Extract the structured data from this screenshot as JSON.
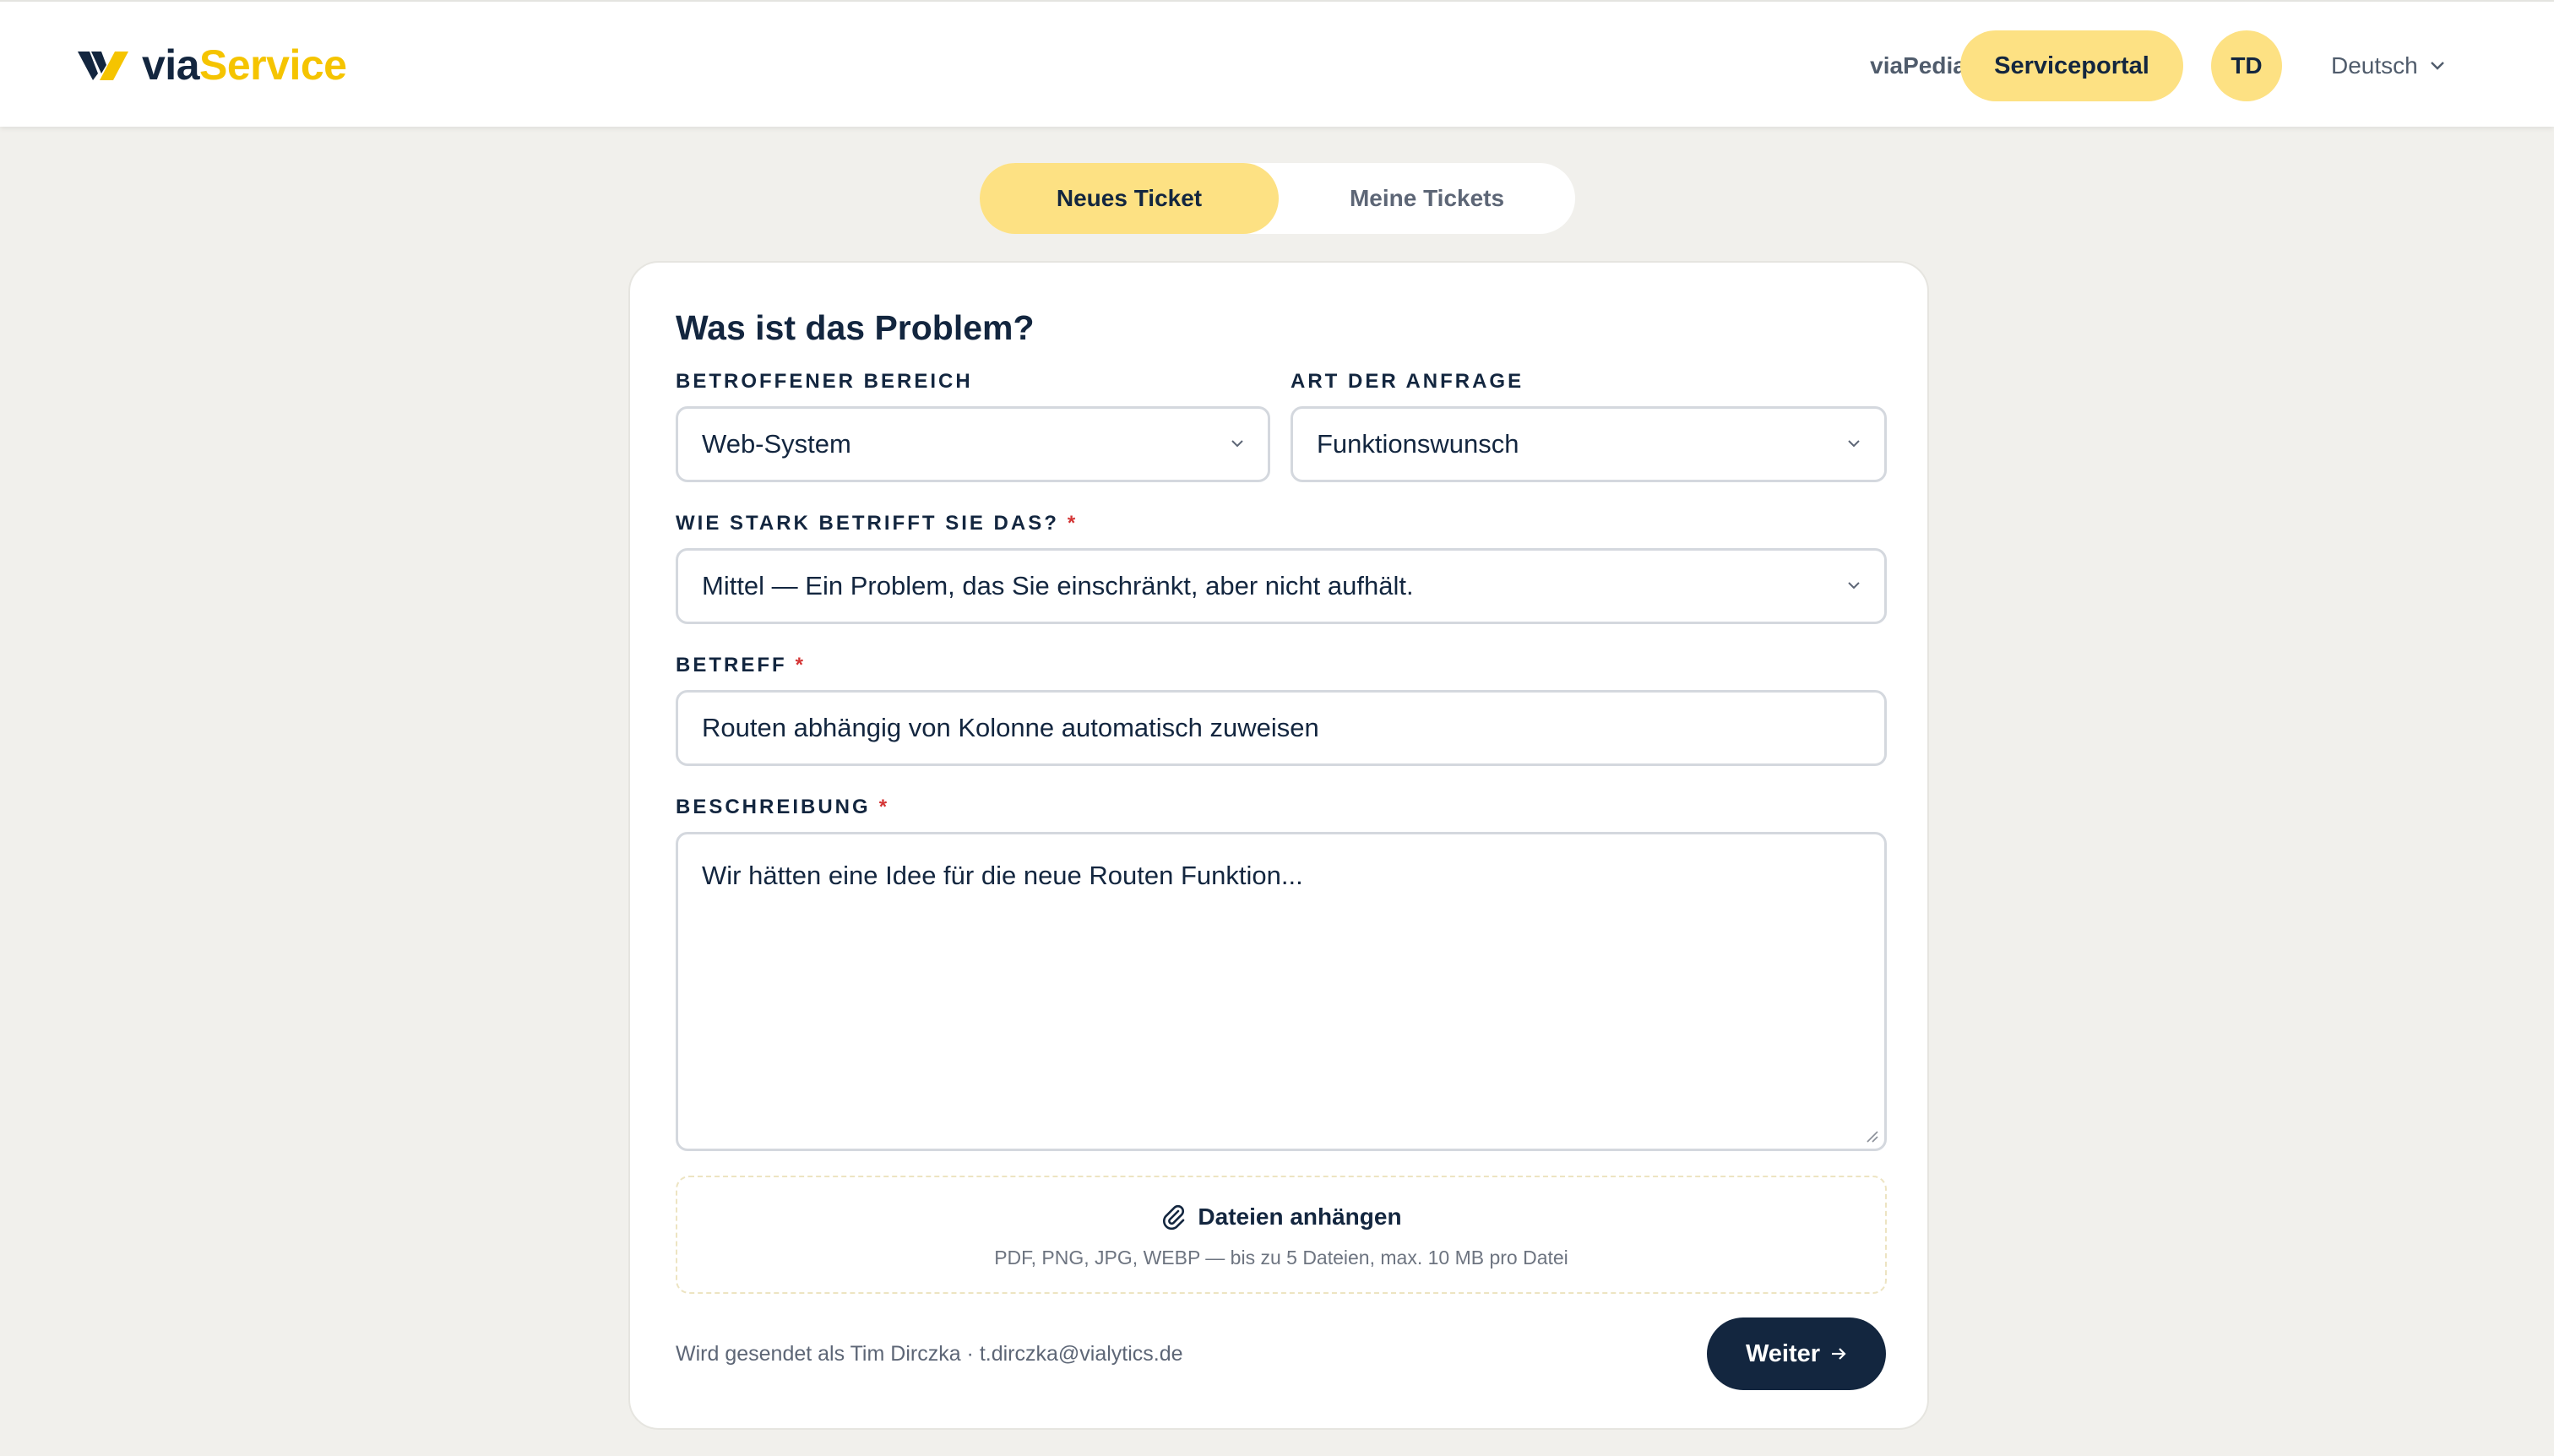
{
  "header": {
    "logo_via": "via",
    "logo_service": "Service",
    "nav": {
      "viapedia": "viaPedia",
      "serviceportal": "Serviceportal",
      "avatar_initials": "TD",
      "language": "Deutsch"
    }
  },
  "tabs": [
    {
      "label": "Neues Ticket",
      "active": true
    },
    {
      "label": "Meine Tickets",
      "active": false
    }
  ],
  "form": {
    "title": "Was ist das Problem?",
    "bereich": {
      "label": "Betroffener Bereich",
      "value": "Web-System"
    },
    "art": {
      "label": "Art der Anfrage",
      "value": "Funktionswunsch"
    },
    "dringlichkeit": {
      "label": "Wie stark betrifft Sie das?",
      "required_mark": "*",
      "value": "Mittel — Ein Problem, das Sie einschränkt, aber nicht aufhält."
    },
    "betreff": {
      "label": "Betreff",
      "required_mark": "*",
      "value": "Routen abhängig von Kolonne automatisch zuweisen"
    },
    "beschreibung": {
      "label": "Beschreibung",
      "required_mark": "*",
      "value": "Wir hätten eine Idee für die neue Routen Funktion..."
    },
    "attach": {
      "label": "Dateien anhängen",
      "hint": "PDF, PNG, JPG, WEBP — bis zu 5 Dateien, max. 10 MB pro Datei"
    },
    "sender_note": "Wird gesendet als Tim Dirczka · t.dirczka@vialytics.de",
    "submit_label": "Weiter"
  },
  "colors": {
    "brand_yellow": "#f5c400",
    "pill_yellow": "#fde183",
    "navy": "#13263f",
    "page_bg": "#f1f0ec",
    "required_red": "#d43434"
  },
  "icons": [
    "chevron-down-icon",
    "paperclip-icon",
    "arrow-right-icon",
    "logo-mark-icon"
  ]
}
